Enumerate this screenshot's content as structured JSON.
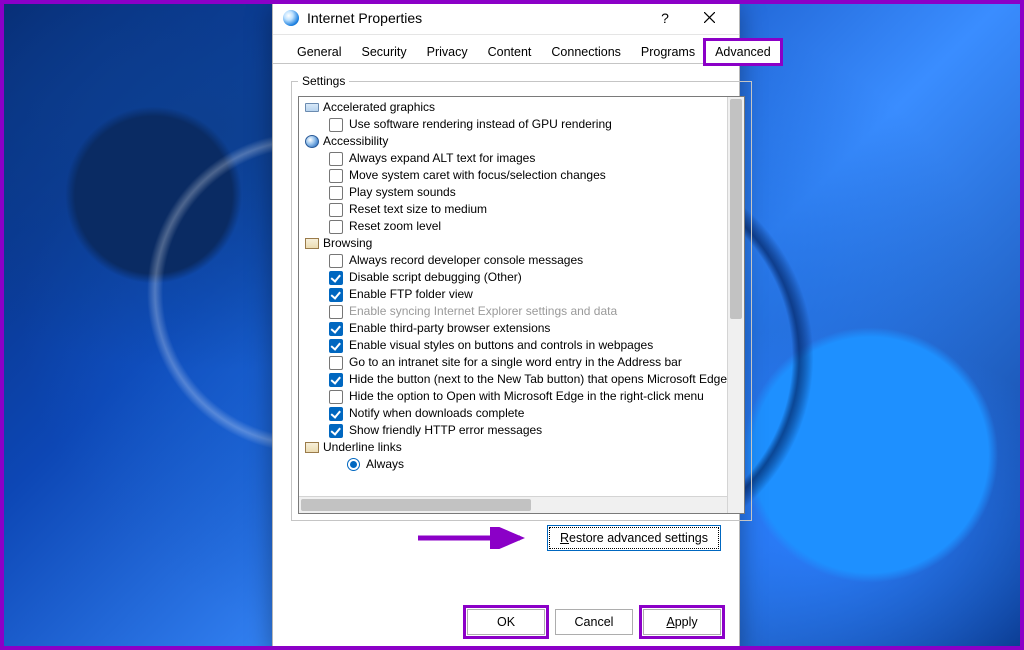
{
  "window": {
    "title": "Internet Properties",
    "help_tooltip": "?",
    "close_tooltip": "Close"
  },
  "tabs": {
    "items": [
      "General",
      "Security",
      "Privacy",
      "Content",
      "Connections",
      "Programs",
      "Advanced"
    ],
    "active": "Advanced"
  },
  "settings": {
    "legend": "Settings",
    "groups": [
      {
        "name": "Accelerated graphics",
        "icon": "monitor",
        "items": [
          {
            "label": "Use software rendering instead of GPU rendering",
            "checked": false
          }
        ]
      },
      {
        "name": "Accessibility",
        "icon": "access",
        "items": [
          {
            "label": "Always expand ALT text for images",
            "checked": false
          },
          {
            "label": "Move system caret with focus/selection changes",
            "checked": false
          },
          {
            "label": "Play system sounds",
            "checked": false
          },
          {
            "label": "Reset text size to medium",
            "checked": false
          },
          {
            "label": "Reset zoom level",
            "checked": false
          }
        ]
      },
      {
        "name": "Browsing",
        "icon": "scroll",
        "items": [
          {
            "label": "Always record developer console messages",
            "checked": false
          },
          {
            "label": "Disable script debugging (Other)",
            "checked": true
          },
          {
            "label": "Enable FTP folder view",
            "checked": true
          },
          {
            "label": "Enable syncing Internet Explorer settings and data",
            "checked": false,
            "disabled": true
          },
          {
            "label": "Enable third-party browser extensions",
            "checked": true
          },
          {
            "label": "Enable visual styles on buttons and controls in webpages",
            "checked": true
          },
          {
            "label": "Go to an intranet site for a single word entry in the Address bar",
            "checked": false
          },
          {
            "label": "Hide the button (next to the New Tab button) that opens Microsoft Edge",
            "checked": true
          },
          {
            "label": "Hide the option to Open with Microsoft Edge in the right-click menu",
            "checked": false
          },
          {
            "label": "Notify when downloads complete",
            "checked": true
          },
          {
            "label": "Show friendly HTTP error messages",
            "checked": true
          }
        ]
      },
      {
        "name": "Underline links",
        "icon": "scroll",
        "items": [
          {
            "label": "Always",
            "type": "radio",
            "checked": true,
            "partial": true
          }
        ]
      }
    ],
    "restore_label": "Restore advanced settings"
  },
  "buttons": {
    "ok": "OK",
    "cancel": "Cancel",
    "apply": "Apply"
  },
  "annotation": {
    "color": "#8b00c7"
  }
}
